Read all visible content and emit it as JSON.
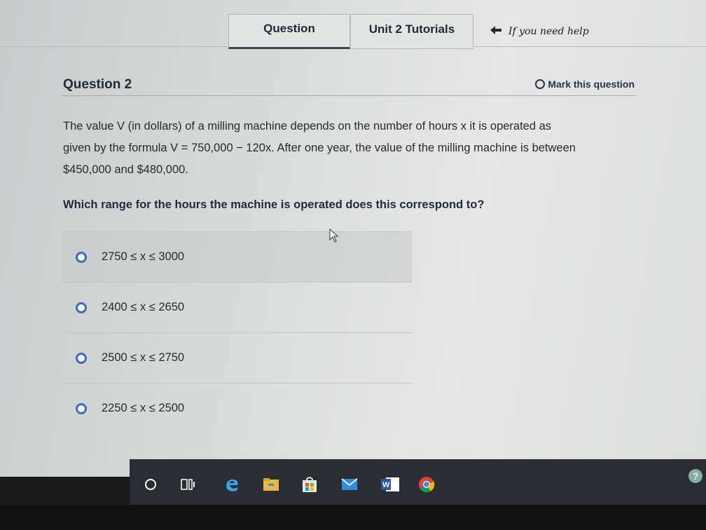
{
  "nav": {
    "tabs": [
      {
        "label": "Question"
      },
      {
        "label": "Unit 2 Tutorials"
      }
    ],
    "help": {
      "icon": "back-arrow-icon",
      "text": "If you need help"
    }
  },
  "question": {
    "title": "Question 2",
    "mark_label": "Mark this question",
    "prompt_line1": "The value V (in dollars) of a milling machine depends on the number of hours x it is operated as",
    "prompt_line2": "given by the formula V = 750,000 − 120x. After one year, the value of the milling machine is between",
    "prompt_line3": "$450,000 and $480,000.",
    "ask": "Which range for the hours the machine is operated does this correspond to?"
  },
  "options": [
    {
      "label": "2750 ≤ x ≤ 3000"
    },
    {
      "label": "2400 ≤ x ≤ 2650"
    },
    {
      "label": "2500 ≤ x ≤ 2750"
    },
    {
      "label": "2250 ≤ x ≤ 2500"
    }
  ],
  "taskbar": {
    "icons": [
      "cortana-circle-icon",
      "task-view-icon",
      "edge-icon",
      "file-explorer-icon",
      "store-icon",
      "mail-icon",
      "word-icon",
      "chrome-icon",
      "help-icon"
    ]
  },
  "colors": {
    "accent": "#3a6fbf",
    "title": "#1e2b38",
    "taskbar": "#2a2e33"
  }
}
